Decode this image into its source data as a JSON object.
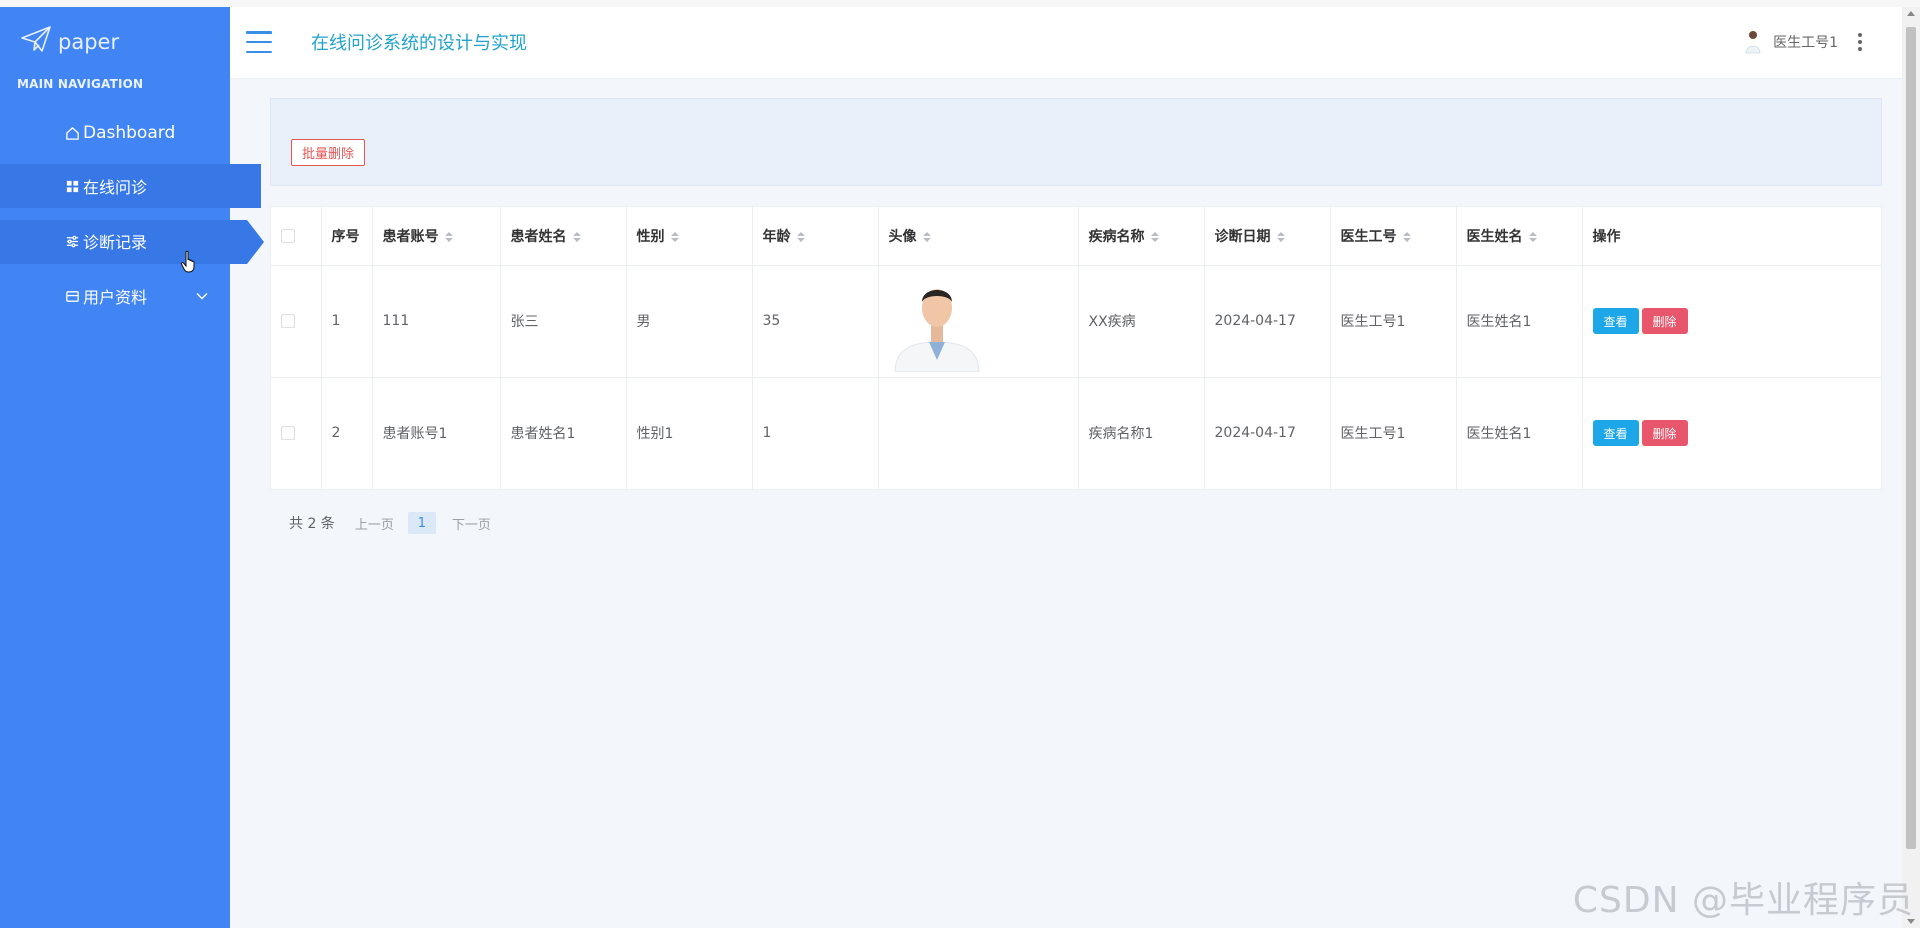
{
  "app": {
    "logo_text": "paper",
    "title": "在线问诊系统的设计与实现"
  },
  "sidebar": {
    "section_header": "MAIN NAVIGATION",
    "items": [
      {
        "label": "Dashboard",
        "icon": "home-icon"
      },
      {
        "label": "在线问诊",
        "icon": "grid-icon"
      },
      {
        "label": "诊断记录",
        "icon": "sliders-icon"
      },
      {
        "label": "用户资料",
        "icon": "profile-icon"
      }
    ]
  },
  "header": {
    "user_name": "医生工号1"
  },
  "toolbar": {
    "batch_delete_label": "批量删除"
  },
  "table": {
    "columns": [
      "序号",
      "患者账号",
      "患者姓名",
      "性别",
      "年龄",
      "头像",
      "疾病名称",
      "诊断日期",
      "医生工号",
      "医生姓名",
      "操作"
    ],
    "rows": [
      {
        "index": "1",
        "account": "111",
        "name": "张三",
        "gender": "男",
        "age": "35",
        "disease": "XX疾病",
        "date": "2024-04-17",
        "doctor_id": "医生工号1",
        "doctor_name": "医生姓名1"
      },
      {
        "index": "2",
        "account": "患者账号1",
        "name": "患者姓名1",
        "gender": "性别1",
        "age": "1",
        "disease": "疾病名称1",
        "date": "2024-04-17",
        "doctor_id": "医生工号1",
        "doctor_name": "医生姓名1"
      }
    ],
    "view_label": "查看",
    "delete_label": "删除"
  },
  "pagination": {
    "total": "共 2 条",
    "prev": "上一页",
    "current": "1",
    "next": "下一页"
  },
  "watermark": "CSDN @毕业程序员",
  "colors": {
    "sidebar": "#4185f4",
    "sidebar_active": "#3777e6",
    "title": "#22a3cc",
    "view_button": "#1ea7e8",
    "delete_button": "#e8566b"
  }
}
